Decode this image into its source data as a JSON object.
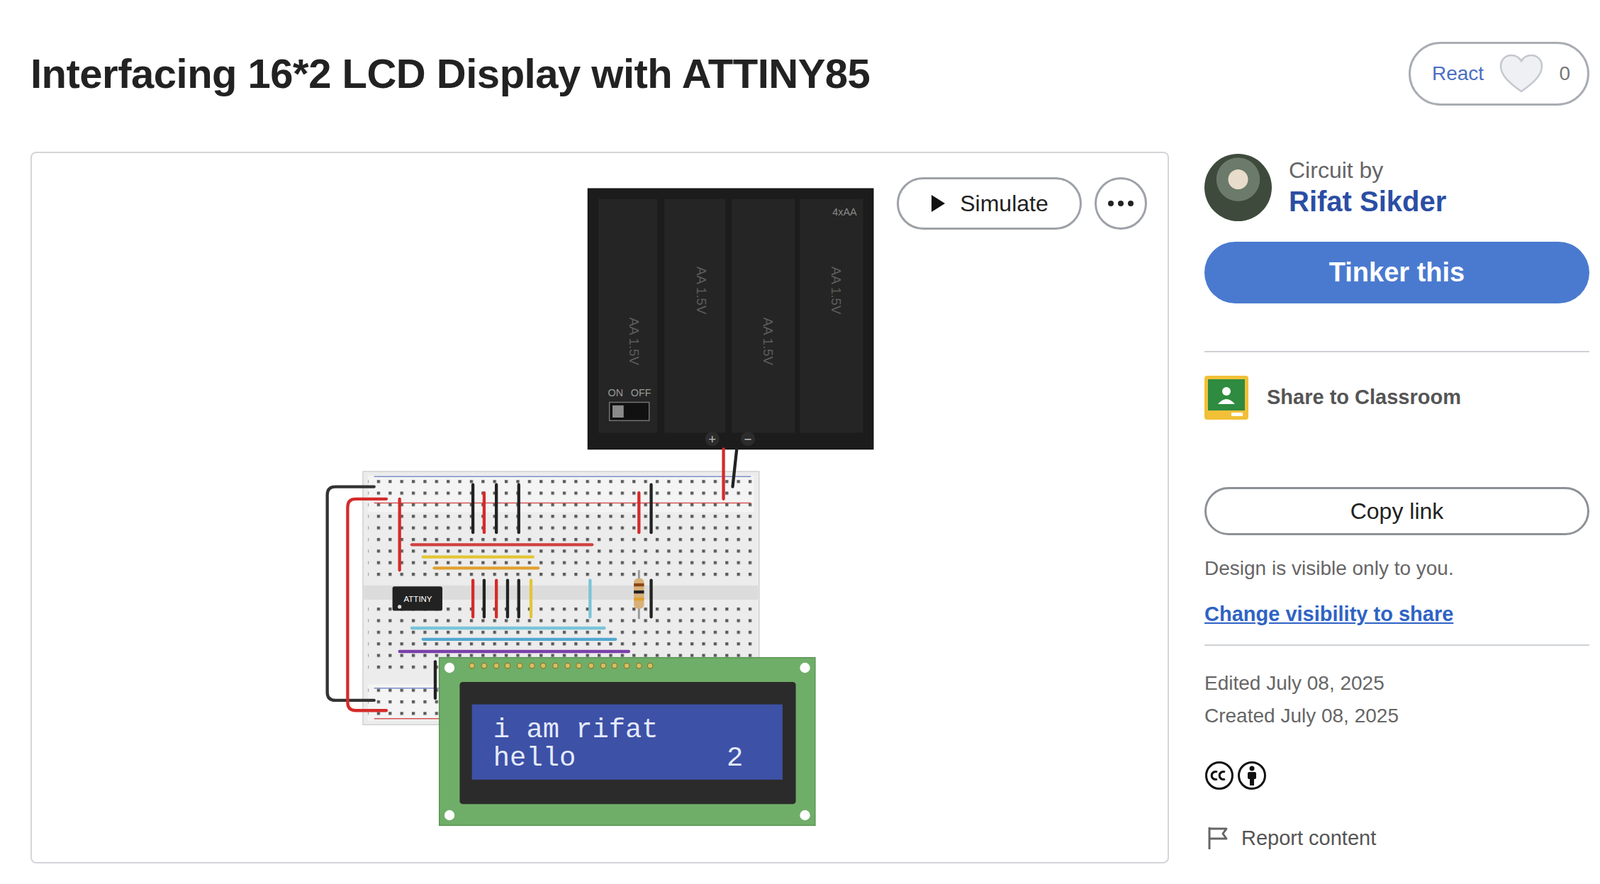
{
  "page": {
    "title": "Interfacing 16*2 LCD Display with ATTINY85"
  },
  "react": {
    "label": "React",
    "count": "0",
    "reacted": false
  },
  "canvas": {
    "simulate": "Simulate"
  },
  "circuit": {
    "battery": {
      "label": "4xAA",
      "cells": [
        "AA 1.5V",
        "AA 1.5V",
        "AA 1.5V",
        "AA 1.5V"
      ],
      "switch": [
        "ON",
        "OFF"
      ],
      "terminals": [
        "+",
        "−"
      ]
    },
    "chip": "ATTINY",
    "lcd": {
      "lines": [
        "i am rifat",
        "hello"
      ],
      "counter": "2"
    }
  },
  "author": {
    "caption": "Circuit by",
    "name": "Rifat Sikder"
  },
  "actions": {
    "tinker": "Tinker this",
    "classroom": "Share to Classroom",
    "copy": "Copy link"
  },
  "visibility": {
    "note": "Design is visible only to you.",
    "link": "Change visibility to share"
  },
  "dates": [
    "Edited July 08, 2025",
    "Created July 08, 2025"
  ],
  "report": "Report content"
}
